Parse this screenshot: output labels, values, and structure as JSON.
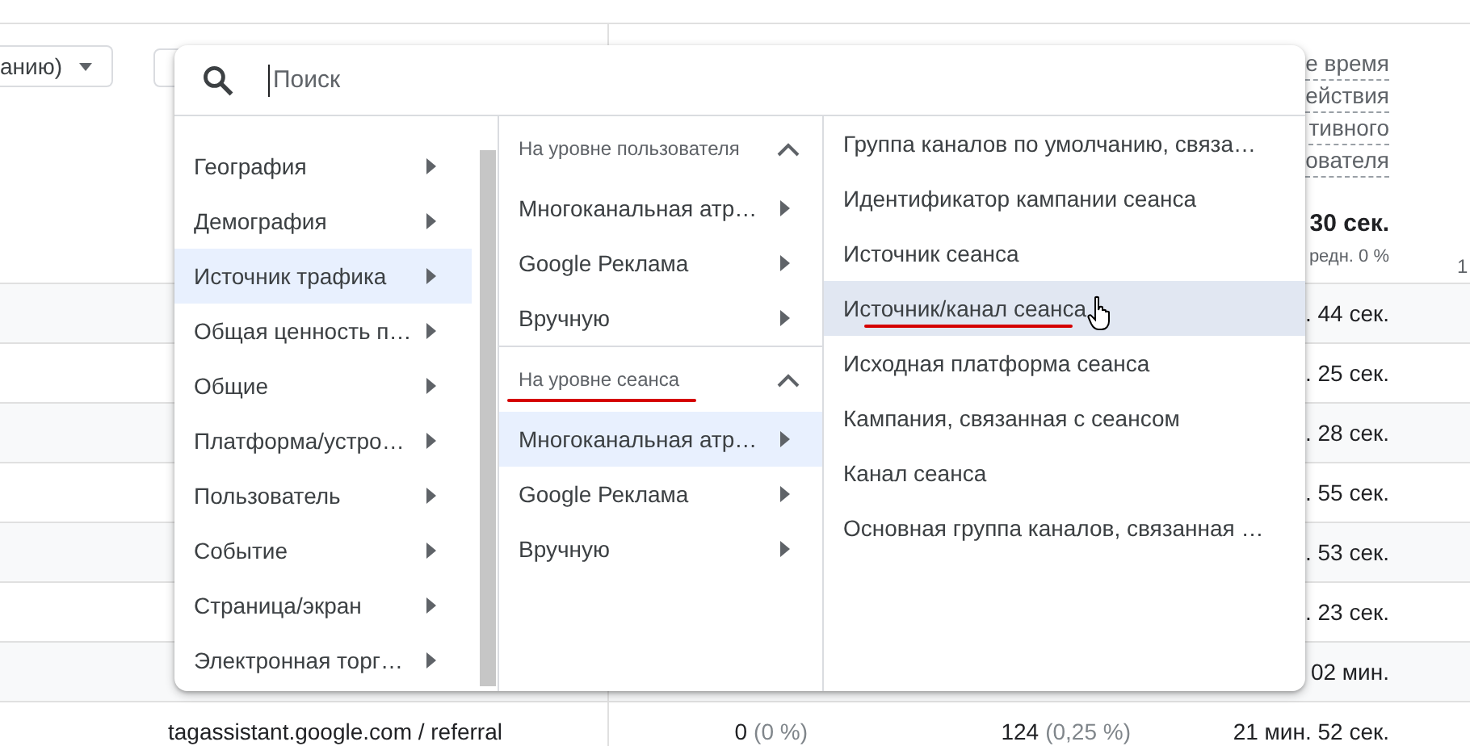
{
  "toolbar": {
    "dropdown_text": "анию)"
  },
  "table": {
    "header_lines": [
      "е время",
      "ействия",
      "тивного",
      "ователя"
    ],
    "totals": {
      "time": "30 сек.",
      "time_note": "редн. 0 %",
      "column_5": "1"
    },
    "rows": [
      {
        "time": ". 44 сек."
      },
      {
        "time": ". 25 сек."
      },
      {
        "time": ". 28 сек."
      },
      {
        "time": ". 55 сек."
      },
      {
        "time": ". 53 сек."
      },
      {
        "time": ". 23 сек."
      },
      {
        "time": "02 мин."
      },
      {
        "dimension": "tagassistant.google.com / referral",
        "metric_1": "0",
        "metric_1_share": "(0 %)",
        "metric_2": "124",
        "metric_2_share": "(0,25 %)",
        "time": "21 мин. 52 сек."
      }
    ]
  },
  "menu": {
    "search": {
      "placeholder": "Поиск"
    },
    "categories": [
      {
        "label": "География",
        "selected": false
      },
      {
        "label": "Демография",
        "selected": false
      },
      {
        "label": "Источник трафика",
        "selected": true
      },
      {
        "label": "Общая ценность п…",
        "selected": false
      },
      {
        "label": "Общие",
        "selected": false
      },
      {
        "label": "Платформа/устро…",
        "selected": false
      },
      {
        "label": "Пользователь",
        "selected": false
      },
      {
        "label": "Событие",
        "selected": false
      },
      {
        "label": "Страница/экран",
        "selected": false
      },
      {
        "label": "Электронная торг…",
        "selected": false
      }
    ],
    "groups": [
      {
        "header": "На уровне пользователя",
        "expanded": true,
        "underlined": false,
        "items": [
          {
            "label": "Многоканальная атр…",
            "selected": false
          },
          {
            "label": "Google Реклама",
            "selected": false
          },
          {
            "label": "Вручную",
            "selected": false
          }
        ]
      },
      {
        "header": "На уровне сеанса",
        "expanded": true,
        "underlined": true,
        "items": [
          {
            "label": "Многоканальная атр…",
            "selected": true
          },
          {
            "label": "Google Реклама",
            "selected": false
          },
          {
            "label": "Вручную",
            "selected": false
          }
        ]
      }
    ],
    "options": [
      {
        "label": "Группа каналов по умолчанию, связа…",
        "selected": false,
        "underlined": false,
        "hovered": false
      },
      {
        "label": "Идентификатор кампании сеанса",
        "selected": false,
        "underlined": false,
        "hovered": false
      },
      {
        "label": "Источник сеанса",
        "selected": false,
        "underlined": false,
        "hovered": false
      },
      {
        "label": "Источник/канал сеанса",
        "selected": true,
        "underlined": true,
        "hovered": true
      },
      {
        "label": "Исходная платформа сеанса",
        "selected": false,
        "underlined": false,
        "hovered": false
      },
      {
        "label": "Кампания, связанная с сеансом",
        "selected": false,
        "underlined": false,
        "hovered": false
      },
      {
        "label": "Канал сеанса",
        "selected": false,
        "underlined": false,
        "hovered": false
      },
      {
        "label": "Основная группа каналов, связанная …",
        "selected": false,
        "underlined": false,
        "hovered": false
      }
    ]
  }
}
